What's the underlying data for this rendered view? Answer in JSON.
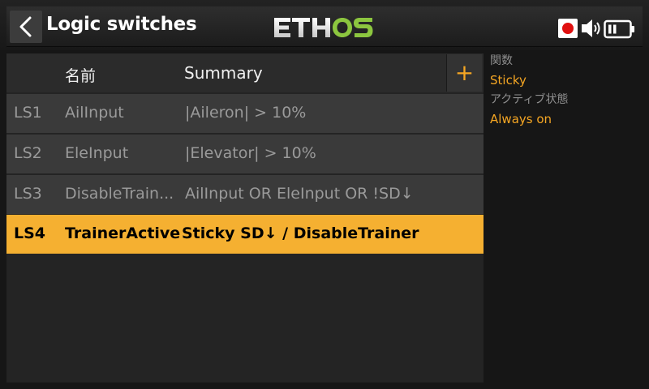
{
  "header": {
    "title": "Logic switches",
    "logo_text": "ETHOS"
  },
  "table": {
    "col_name": "名前",
    "col_summary": "Summary",
    "add_label": "+",
    "rows": [
      {
        "id": "LS1",
        "name": "AilInput",
        "summary": "|Aileron| > 10%"
      },
      {
        "id": "LS2",
        "name": "EleInput",
        "summary": "|Elevator| > 10%"
      },
      {
        "id": "LS3",
        "name": "DisableTrain...",
        "summary": "AilInput OR EleInput OR !SD↓"
      },
      {
        "id": "LS4",
        "name": "TrainerActive",
        "summary": "Sticky SD↓ / DisableTrainer"
      }
    ],
    "selected_index": 3
  },
  "side_panel": {
    "function_label": "関数",
    "function_value": "Sticky",
    "active_state_label": "アクティブ状態",
    "active_state_value": "Always on"
  },
  "colors": {
    "accent": "#f5a623",
    "selected_row": "#f5b031",
    "logo_green": "#8cc63f",
    "record_red": "#e01010"
  },
  "icons": [
    "back-arrow-icon",
    "add-icon",
    "record-icon",
    "speaker-icon",
    "battery-icon"
  ]
}
